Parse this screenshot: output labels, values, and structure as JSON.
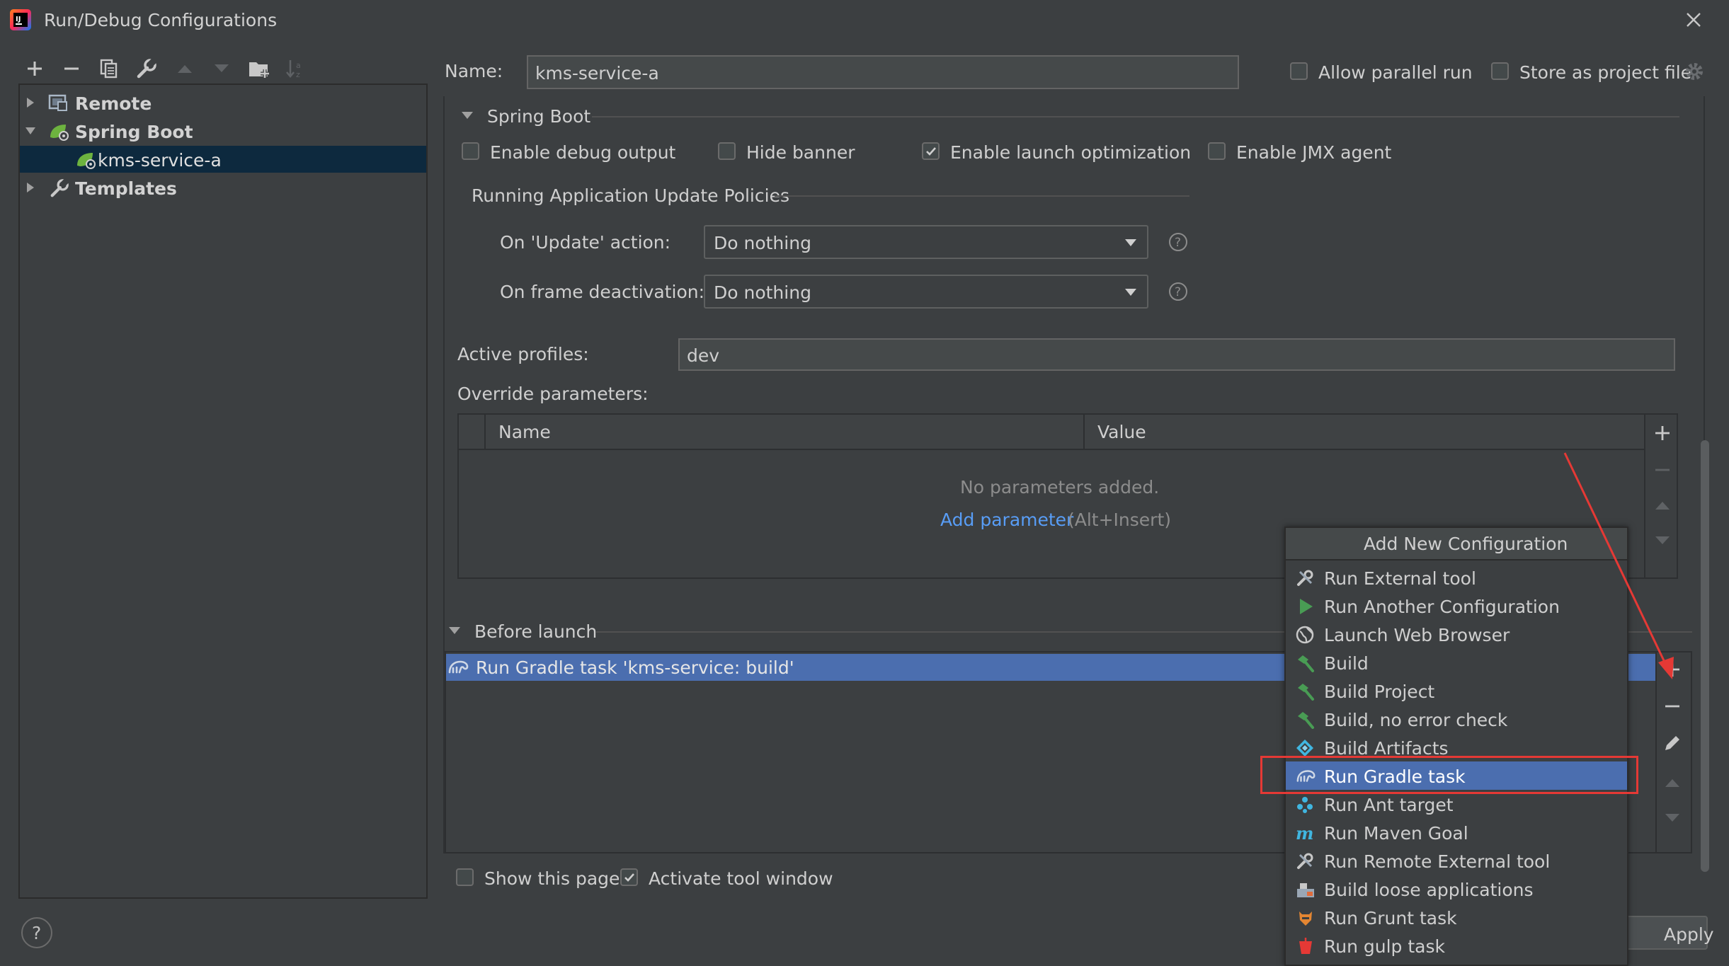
{
  "window": {
    "title": "Run/Debug Configurations"
  },
  "tree": {
    "items": [
      {
        "label": "Remote"
      },
      {
        "label": "Spring Boot"
      },
      {
        "label": "kms-service-a"
      },
      {
        "label": "Templates"
      }
    ]
  },
  "header": {
    "name_label": "Name:",
    "name_value": "kms-service-a",
    "allow_parallel": "Allow parallel run",
    "store_project": "Store as project file"
  },
  "spring_boot": {
    "section_title": "Spring Boot",
    "enable_debug": "Enable debug output",
    "hide_banner": "Hide banner",
    "enable_launch_opt": "Enable launch optimization",
    "enable_jmx": "Enable JMX agent",
    "policies_title": "Running Application Update Policies",
    "on_update_label": "On 'Update' action:",
    "on_update_value": "Do nothing",
    "on_frame_label": "On frame deactivation:",
    "on_frame_value": "Do nothing",
    "active_profiles_label": "Active profiles:",
    "active_profiles_value": "dev",
    "override_label": "Override parameters:",
    "col_name": "Name",
    "col_value": "Value",
    "empty_text": "No parameters added.",
    "add_param_link": "Add parameter",
    "add_param_shortcut": "(Alt+Insert)"
  },
  "before_launch": {
    "title": "Before launch",
    "task": "Run Gradle task 'kms-service: build'",
    "show_page": "Show this page",
    "activate_tool": "Activate tool window"
  },
  "popup": {
    "title": "Add New Configuration",
    "items": [
      {
        "label": "Run External tool",
        "icon": "external-tool-icon"
      },
      {
        "label": "Run Another Configuration",
        "icon": "run-icon"
      },
      {
        "label": "Launch Web Browser",
        "icon": "globe-icon"
      },
      {
        "label": "Build",
        "icon": "hammer-icon"
      },
      {
        "label": "Build Project",
        "icon": "hammer-icon"
      },
      {
        "label": "Build, no error check",
        "icon": "hammer-icon"
      },
      {
        "label": "Build Artifacts",
        "icon": "artifacts-icon"
      },
      {
        "label": "Run Gradle task",
        "icon": "gradle-icon"
      },
      {
        "label": "Run Ant target",
        "icon": "ant-icon"
      },
      {
        "label": "Run Maven Goal",
        "icon": "maven-icon"
      },
      {
        "label": "Run Remote External tool",
        "icon": "external-tool-icon"
      },
      {
        "label": "Build loose applications",
        "icon": "package-icon"
      },
      {
        "label": "Run Grunt task",
        "icon": "grunt-icon"
      },
      {
        "label": "Run gulp task",
        "icon": "gulp-icon"
      }
    ]
  },
  "footer": {
    "apply": "Apply"
  },
  "colors": {
    "background": "#3c3f41",
    "selection": "#4b6eaf",
    "tree_selection": "#0d293e",
    "link": "#589df6",
    "annotation": "#e53935"
  }
}
